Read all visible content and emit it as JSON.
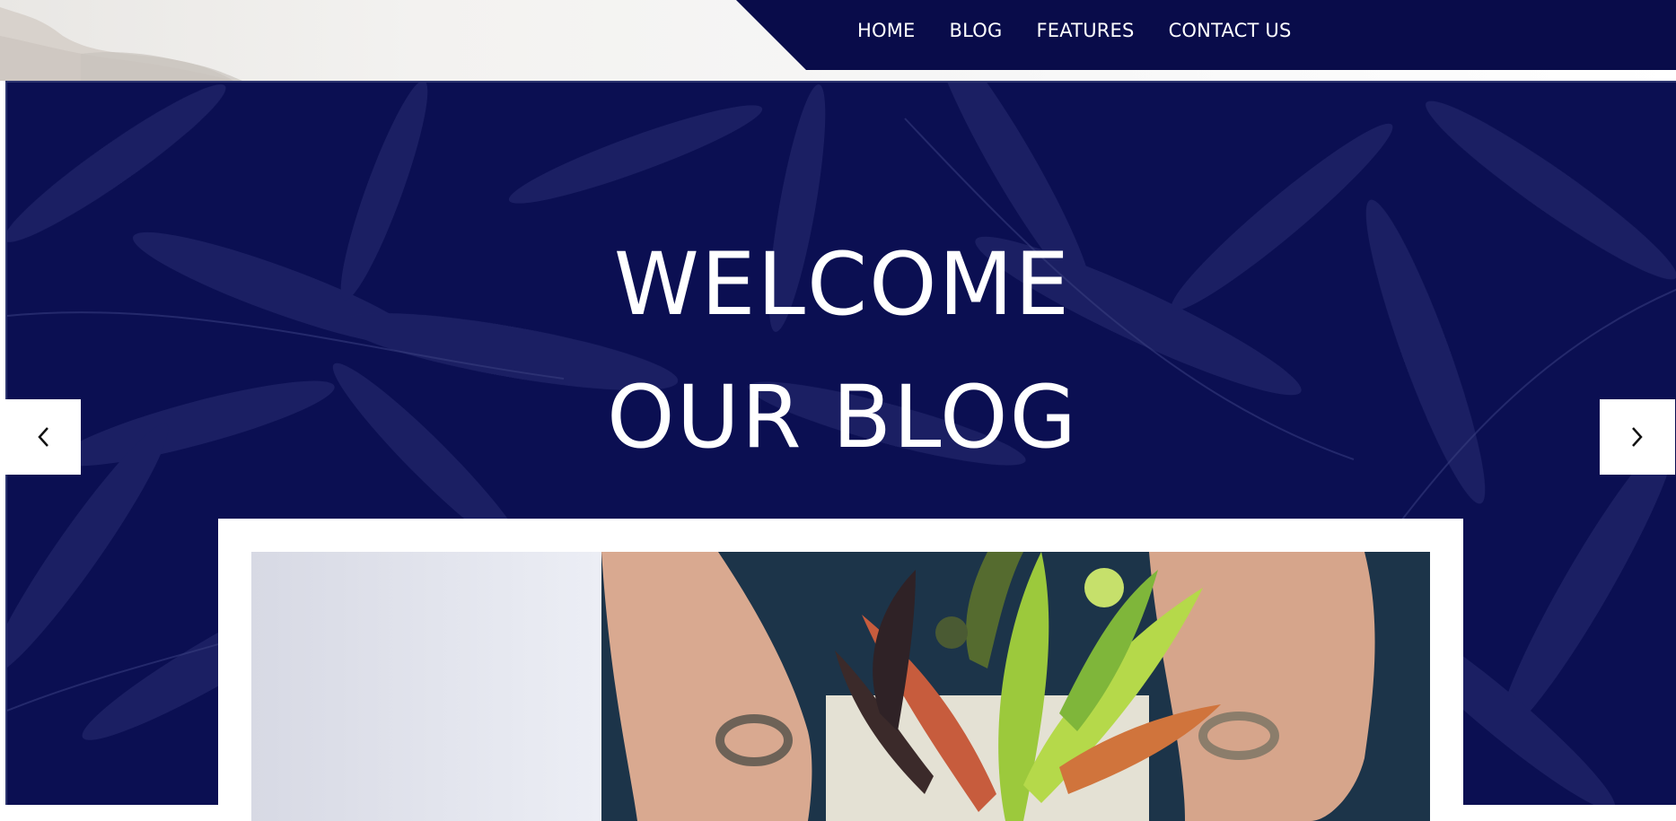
{
  "nav": {
    "items": [
      {
        "label": "HOME"
      },
      {
        "label": "BLOG"
      },
      {
        "label": "FEATURES"
      },
      {
        "label": "CONTACT US"
      }
    ]
  },
  "hero": {
    "title_line1": "WELCOME",
    "title_line2": "OUR BLOG",
    "prev_icon": "chevron-left-icon",
    "next_icon": "chevron-right-icon"
  },
  "post": {
    "image_subject": "hands holding succulent plants"
  },
  "colors": {
    "navy": "#090c4a",
    "hero_bg": "#0b0f52",
    "white": "#ffffff"
  }
}
